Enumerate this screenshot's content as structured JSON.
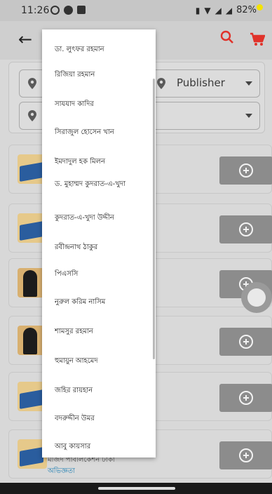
{
  "status_bar": {
    "time": "11:26",
    "battery": "82%"
  },
  "filters": {
    "publisher_label": "Publisher"
  },
  "popup_items": [
    "ডা. লুৎফর রহমান",
    "রিজিয়া রহমান",
    "সাযযাদ কাদির",
    "সিরাজুল হোসেন খান",
    "ইমদাদুল হক মিলন",
    "ড. মুহাম্মদ কুদরাত-এ-খুদা",
    "কুদরাত-এ-খুদা উদ্দীন",
    "রবীন্দ্রনাথ ঠাকুর",
    "পিএসসি",
    "নুরুল করিম নাসিম",
    "শামসুর রহমান",
    "হুমায়ুন আহমেদ",
    "জহির রায়হান",
    "বদরুদ্দীন উমর",
    "আবু কায়সার"
  ],
  "last_book": {
    "publisher": "মজিদ পাবলিকেশন ঢাকা",
    "category": "অভিজ্ঞতা"
  },
  "colors": {
    "accent_red": "#e0322a",
    "badge_yellow": "#f4e300",
    "link_blue": "#1f7fb2"
  }
}
